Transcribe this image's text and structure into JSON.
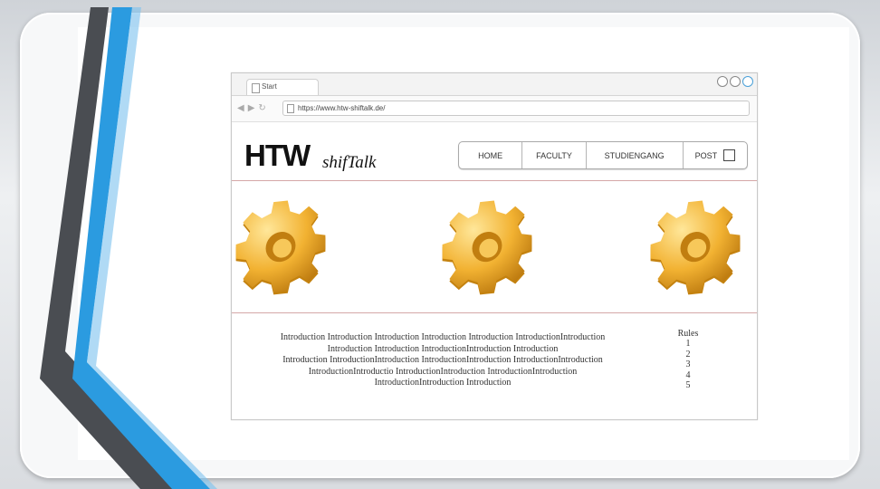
{
  "browser": {
    "tab_label": "Start",
    "url": "https://www.htw-shiftalk.de/",
    "nav_icons": [
      "back-arrow",
      "forward-arrow",
      "reload"
    ]
  },
  "site": {
    "logo_main": "HTW",
    "logo_sub": "shifTalk",
    "nav": [
      "HOME",
      "FACULTY",
      "STUDIENGANG",
      "POST"
    ],
    "intro_lines": [
      "Introduction Introduction Introduction Introduction Introduction IntroductionIntroduction",
      "Introduction Introduction IntroductionIntroduction Introduction",
      "Introduction IntroductionIntroduction IntroductionIntroduction IntroductionIntroduction",
      "IntroductionIntroductio IntroductionIntroduction IntroductionIntroduction",
      "IntroductionIntroduction Introduction"
    ],
    "rules_title": "Rules",
    "rules_items": [
      "1",
      "2",
      "3",
      "4",
      "5"
    ]
  },
  "colors": {
    "accent_blue": "#2b9be0",
    "frame_dark": "#4a4d52",
    "gear_gold": "#f2b232",
    "banner_border": "#d5a7a7"
  },
  "icons": [
    "page-icon",
    "gear-icon",
    "external-link-icon",
    "window-control-icon"
  ]
}
